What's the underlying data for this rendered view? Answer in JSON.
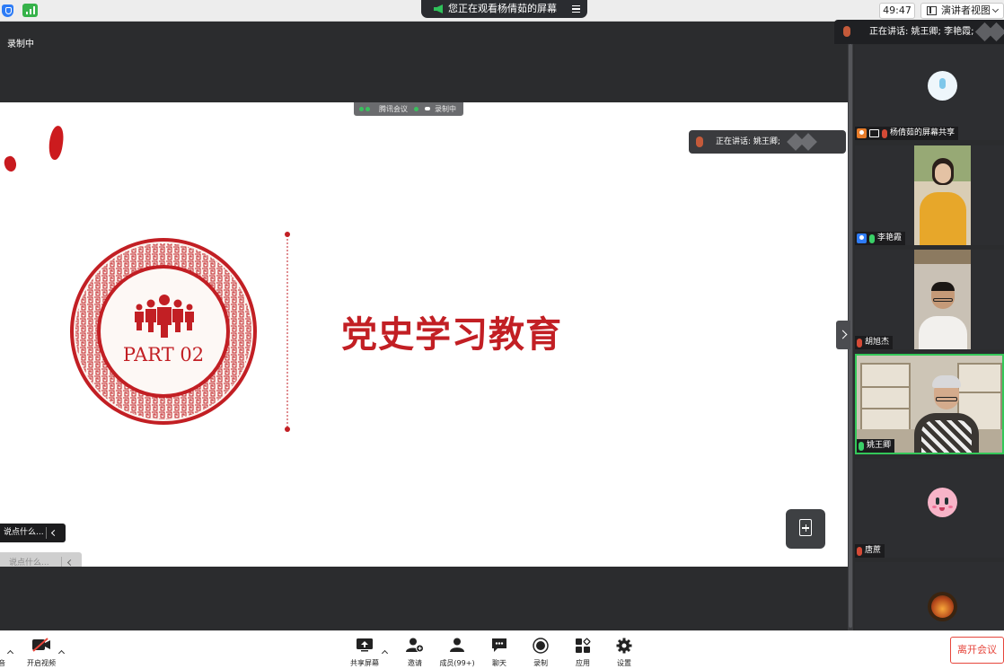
{
  "topbar": {
    "viewing_text": "您正在观看杨倩茹的屏幕",
    "timer": "49:47",
    "view_mode": "演讲者视图"
  },
  "recording_label": "录制中",
  "share_tag": {
    "app_name": "腾讯会议",
    "recording": "录制中"
  },
  "slide": {
    "part_label": "PART 02",
    "title": "党史学习教育",
    "accent_color": "#c21f24"
  },
  "floating_talking": {
    "label": "正在讲话: 姚王卿;"
  },
  "chat": {
    "placeholder_dark": "说点什么...",
    "placeholder_light": "说点什么..."
  },
  "panel": {
    "talking_label": "正在讲话: 姚王卿; 李艳霞;",
    "participants": [
      {
        "name": "杨倩茹的屏幕共享",
        "mic": "muted",
        "role": "host",
        "sharing": true
      },
      {
        "name": "李艳霞",
        "mic": "on",
        "role": "cohost"
      },
      {
        "name": "胡旭杰",
        "mic": "muted"
      },
      {
        "name": "姚王卿",
        "mic": "on",
        "active": true
      },
      {
        "name": "唐蔗",
        "mic": "muted"
      },
      {
        "name": "",
        "mic": "muted"
      }
    ]
  },
  "toolbar": {
    "mute_partial": "音",
    "video": "开启视频",
    "share": "共享屏幕",
    "invite": "邀请",
    "members": "成员(99+)",
    "chat": "聊天",
    "record": "录制",
    "apps": "应用",
    "settings": "设置",
    "leave": "离开会议"
  }
}
